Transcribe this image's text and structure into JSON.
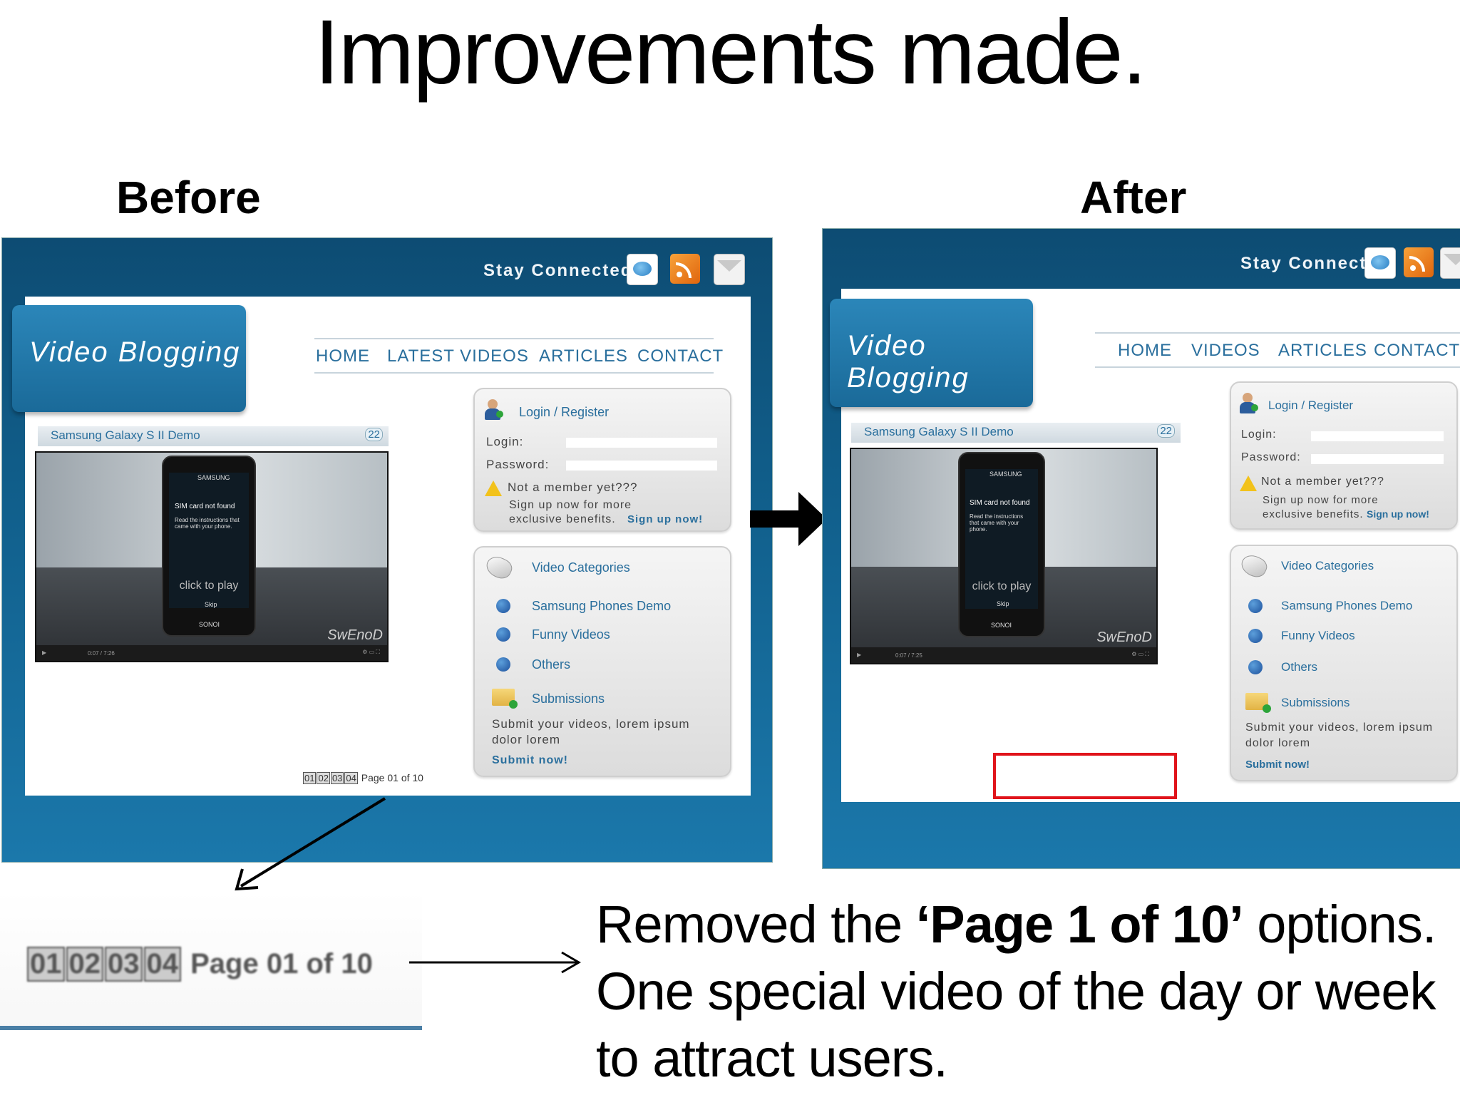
{
  "slide": {
    "title": "Improvements made.",
    "before_label": "Before",
    "after_label": "After"
  },
  "before": {
    "stay_connected": "Stay Connected:",
    "logo": "Video Blogging",
    "nav": [
      "HOME",
      "LATEST VIDEOS",
      "ARTICLES",
      "CONTACT"
    ],
    "video_title": "Samsung Galaxy S II Demo",
    "video_badge": "22",
    "video": {
      "screen_brand": "SAMSUNG",
      "screen_msg": "SIM card not found",
      "screen_sub": "Read the instructions that came with your phone.",
      "play_text": "click to play",
      "screen_btn": "Skip",
      "phone_brand": "SONOI",
      "watermark": "SwEnoD",
      "time": "0:07 / 7:26"
    },
    "login": {
      "header": "Login / Register",
      "login_label": "Login:",
      "password_label": "Password:",
      "not_member": "Not a member yet???",
      "signup_line1": "Sign up now for more",
      "signup_line2": "exclusive benefits.",
      "signup_link": "Sign up now!"
    },
    "categories": {
      "header": "Video Categories",
      "items": [
        "Samsung Phones Demo",
        "Funny Videos",
        "Others"
      ],
      "submissions": "Submissions",
      "submit_line1": "Submit your videos, lorem ipsum",
      "submit_line2": "dolor lorem",
      "submit_link": "Submit now!"
    },
    "pager": {
      "pages": [
        "01",
        "02",
        "03",
        "04"
      ],
      "text": "Page 01 of 10"
    }
  },
  "after": {
    "stay_connected": "Stay Connected:",
    "logo": "Video Blogging",
    "nav": [
      "HOME",
      "VIDEOS",
      "ARTICLES",
      "CONTACT"
    ],
    "video_title": "Samsung Galaxy S II Demo",
    "video_badge": "22",
    "video": {
      "screen_brand": "SAMSUNG",
      "screen_msg": "SIM card not found",
      "screen_sub": "Read the instructions that came with your phone.",
      "play_text": "click to play",
      "screen_btn": "Skip",
      "phone_brand": "SONOI",
      "watermark": "SwEnoD",
      "time": "0:07 / 7:25"
    },
    "login": {
      "header": "Login / Register",
      "login_label": "Login:",
      "password_label": "Password:",
      "not_member": "Not a member yet???",
      "signup_line1": "Sign up now for more",
      "signup_line2": "exclusive benefits.",
      "signup_link": "Sign up now!"
    },
    "categories": {
      "header": "Video Categories",
      "items": [
        "Samsung Phones Demo",
        "Funny Videos",
        "Others"
      ],
      "submissions": "Submissions",
      "submit_line1": "Submit your videos, lorem ipsum",
      "submit_line2": "dolor lorem",
      "submit_link": "Submit now!"
    }
  },
  "zoom": {
    "pages": [
      "01",
      "02",
      "03",
      "04"
    ],
    "text": "Page 01 of 10"
  },
  "caption": {
    "part1": "Removed the ",
    "bold": "‘Page 1 of 10’",
    "part2": " options. One special video of the day or week to attract users."
  },
  "colors": {
    "frame": "#11608d",
    "link": "#2a6f9d",
    "highlight": "#e0141b"
  }
}
